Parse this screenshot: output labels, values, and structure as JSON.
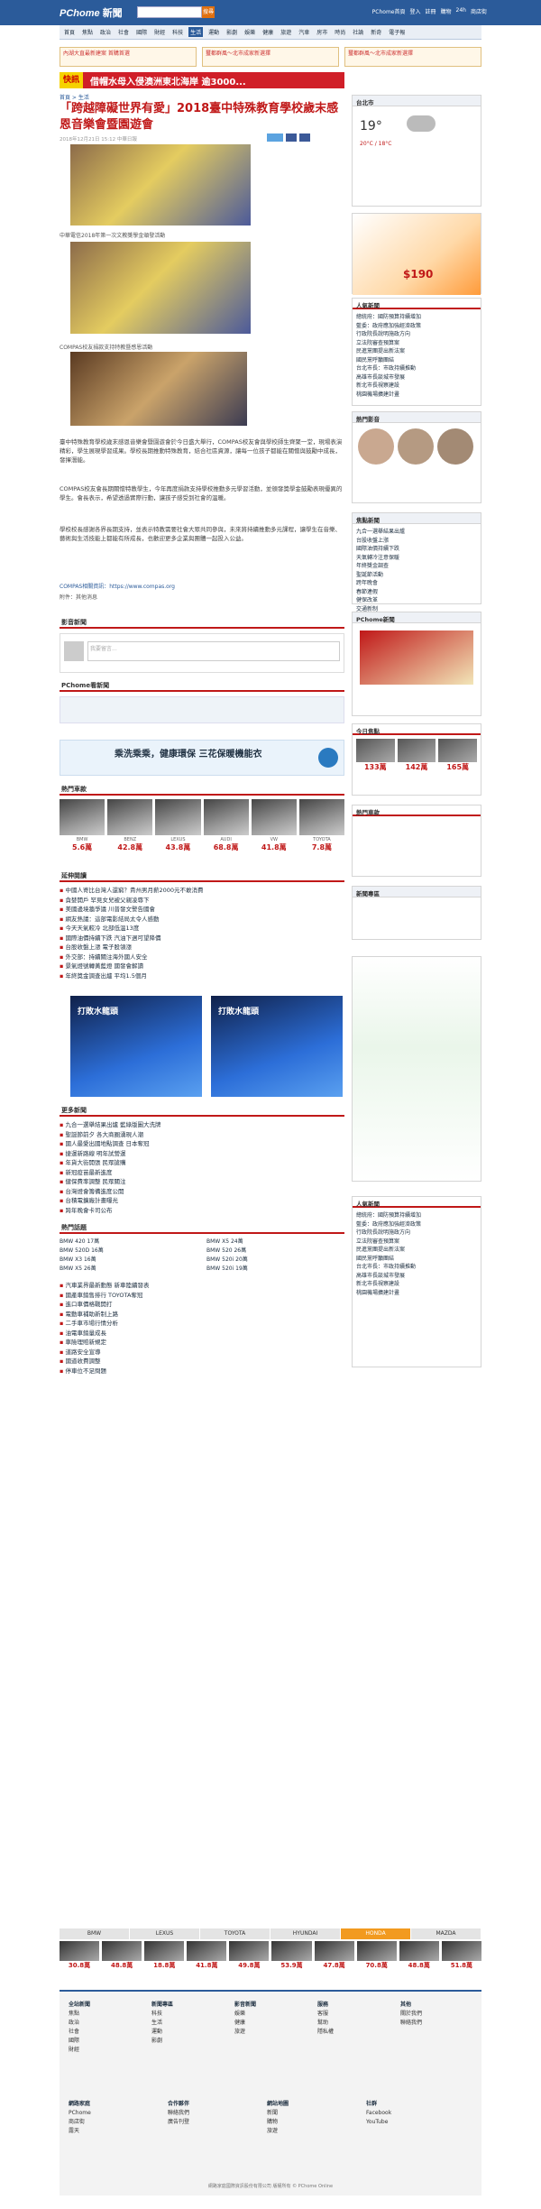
{
  "header": {
    "logo": "PChome",
    "logo2": "新聞",
    "search_btn": "搜尋",
    "links": [
      "PChome首頁",
      "登入",
      "註冊",
      "購物",
      "24h",
      "商店街"
    ]
  },
  "nav": [
    "首頁",
    "焦點",
    "政治",
    "社會",
    "國際",
    "財經",
    "科技",
    "生活",
    "運動",
    "影劇",
    "娛樂",
    "健康",
    "旅遊",
    "汽車",
    "房市",
    "時尚",
    "社論",
    "新奇",
    "電子報"
  ],
  "ads": [
    "內湖大直最新建案 首購首選",
    "璽都群風～北市成家新選擇",
    "璽都群風～北市成家新選擇"
  ],
  "flash": {
    "label": "快訊",
    "text": "借帽水母入侵澳洲東北海岸 逾3000..."
  },
  "breadcrumb": "首頁 > 生活",
  "article": {
    "title": "「跨越障礙世界有愛」2018臺中特殊教育學校歲末感恩音樂會暨園遊會",
    "meta": "2018年12月21日 15:12 中華日報",
    "cap1": "中華電信2018年第一次文教獎學金頒發活動",
    "cap2": "COMPAS校友捐款支持特教暨感恩活動",
    "cap3": "COMPAS校友捐款感謝學校師長",
    "p1": "臺中特殊教育學校歲末感恩音樂會暨園遊會於今日盛大舉行，COMPAS校友會與學校師生齊聚一堂，現場表演精彩，學生展現學習成果。學校長期推動特殊教育，結合社區資源，讓每一位孩子都能在關懷與鼓勵中成長，發揮潛能。",
    "p2": "COMPAS校友會長期關懷特教學生，今年再度捐款支持學校推動多元學習活動，並頒發獎學金鼓勵表現優異的學生。會長表示，希望透過實際行動，讓孩子感受到社會的溫暖。",
    "p3": "學校校長感謝各界長期支持，並表示特教需要社會大眾共同參與，未來將持續推動多元課程，讓學生在音樂、藝術與生活技能上都能有所成長，也歡迎更多企業與團體一起投入公益。",
    "source": "COMPAS相關資訊：https://www.compas.org",
    "related": "附件：其他消息"
  },
  "sections": {
    "video": "影音新聞",
    "comment": "留言",
    "feature": "PChome看新聞",
    "cars": "熱門車款",
    "news": "延伸閱讀",
    "more": "更多新聞",
    "hot": "熱門話題"
  },
  "comment_placeholder": "我要留言...",
  "blue_ad": "乘洗乘乘，健康環保 三花保暖機能衣",
  "cars": [
    {
      "n": "BMW",
      "p": "5.6萬"
    },
    {
      "n": "BENZ",
      "p": "42.8萬"
    },
    {
      "n": "LEXUS",
      "p": "43.8萬"
    },
    {
      "n": "AUDI",
      "p": "68.8萬"
    },
    {
      "n": "VW",
      "p": "41.8萬"
    },
    {
      "n": "TOYOTA",
      "p": "7.8萬"
    }
  ],
  "news": [
    "中國人寄比台灣人還窮？貴州男月薪2000元不敢消費",
    "貪婪開戶 罕見女兒被父親凌辱下",
    "美國邊境牆爭議 川普發文警告國會",
    "網友熱議：這部電影結局太令人感動",
    "今天天氣較冷 北部低溫13度",
    "國際油價持續下跌 汽油下週可望降價",
    "台股收盤上漲 電子股領漲",
    "外交部：持續關注海外國人安全",
    "景氣燈號轉黃藍燈 國發會解讀",
    "年終獎金調查出爐 平均1.5個月"
  ],
  "ad_big": [
    "打敗水龍頭",
    "打敗水龍頭"
  ],
  "news2": [
    "九合一選舉結果出爐 藍綠版圖大洗牌",
    "聖誕節前夕 各大商圈湧現人潮",
    "國人最愛出國地點調查 日本奪冠",
    "捷運新路線 明年試營運",
    "年貨大街開張 民眾搶購",
    "新冠疫苗最新進度",
    "健保費率調整 民眾關注",
    "台灣燈會籌備進度公開",
    "台積電擴廠計畫曝光",
    "跨年晚會卡司公布"
  ],
  "twocol": [
    "BMW 420 17萬",
    "BMW X5 24萬",
    "BMW 520D 16萬",
    "BMW 520 26萬",
    "BMW X3 16萬",
    "BMW 520i 20萬",
    "BMW X5 26萬",
    "BMW 520i 19萬"
  ],
  "news3": [
    "汽車業界最新動態 新車陸續發表",
    "國產車銷售排行 TOYOTA奪冠",
    "進口車價格戰開打",
    "電動車補助新制上路",
    "二手車市場行情分析",
    "油電車銷量成長",
    "車險理賠新規定",
    "道路安全宣導",
    "國道收費調整",
    "停車位不足問題"
  ],
  "weather": {
    "temp": "19°",
    "range": "20°C / 18°C",
    "city": "台北市"
  },
  "side_boxes": {
    "ranking": "人氣新聞",
    "tv": "熱門影音",
    "brief": "焦點新聞",
    "fb": "PChome新聞",
    "shop": "今日焦點",
    "hot": "熱門車款",
    "tag": "新聞專區"
  },
  "side_list": [
    "總統府：國防預算持續增加",
    "藍委：政府應加強經濟政策",
    "行政院長說明施政方向",
    "立法院審查預算案",
    "民進黨團提出新法案",
    "國民黨呼籲團結",
    "台北市長：市政持續推動",
    "高雄市長談城市發展",
    "新北市長視察建設",
    "桃園機場擴建計畫"
  ],
  "side_price": "$190",
  "side_list2": [
    "九合一選舉結果出爐",
    "台股收盤上漲",
    "國際油價持續下跌",
    "天氣轉冷注意保暖",
    "年終獎金調查",
    "聖誕節活動",
    "跨年晚會",
    "春節連假",
    "健保改革",
    "交通新制"
  ],
  "side_cars": [
    "133萬",
    "142萬",
    "165萬"
  ],
  "brands": [
    "BMW",
    "LEXUS",
    "TOYOTA",
    "HYUNDAI",
    "HONDA",
    "MAZDA"
  ],
  "brand_prices": [
    "30.8萬",
    "48.8萬",
    "18.8萬",
    "41.8萬",
    "49.8萬",
    "53.9萬",
    "47.8萬",
    "70.8萬",
    "48.8萬",
    "51.8萬"
  ],
  "footer": [
    {
      "t": "全站新聞",
      "i": [
        "焦點",
        "政治",
        "社會",
        "國際",
        "財經"
      ]
    },
    {
      "t": "新聞專區",
      "i": [
        "科技",
        "生活",
        "運動",
        "影劇"
      ]
    },
    {
      "t": "影音新聞",
      "i": [
        "娛樂",
        "健康",
        "旅遊"
      ]
    },
    {
      "t": "服務",
      "i": [
        "客服",
        "幫助",
        "隱私權"
      ]
    },
    {
      "t": "其他",
      "i": [
        "關於我們",
        "聯絡我們"
      ]
    }
  ],
  "footer2": [
    {
      "t": "網路家庭",
      "i": [
        "PChome",
        "商店街",
        "露天"
      ]
    },
    {
      "t": "合作夥伴",
      "i": [
        "聯絡我們",
        "廣告刊登"
      ]
    },
    {
      "t": "網站地圖",
      "i": [
        "新聞",
        "購物",
        "旅遊"
      ]
    },
    {
      "t": "社群",
      "i": [
        "Facebook",
        "YouTube"
      ]
    }
  ],
  "copyright": "網路家庭國際資訊股份有限公司 版權所有 © PChome Online"
}
